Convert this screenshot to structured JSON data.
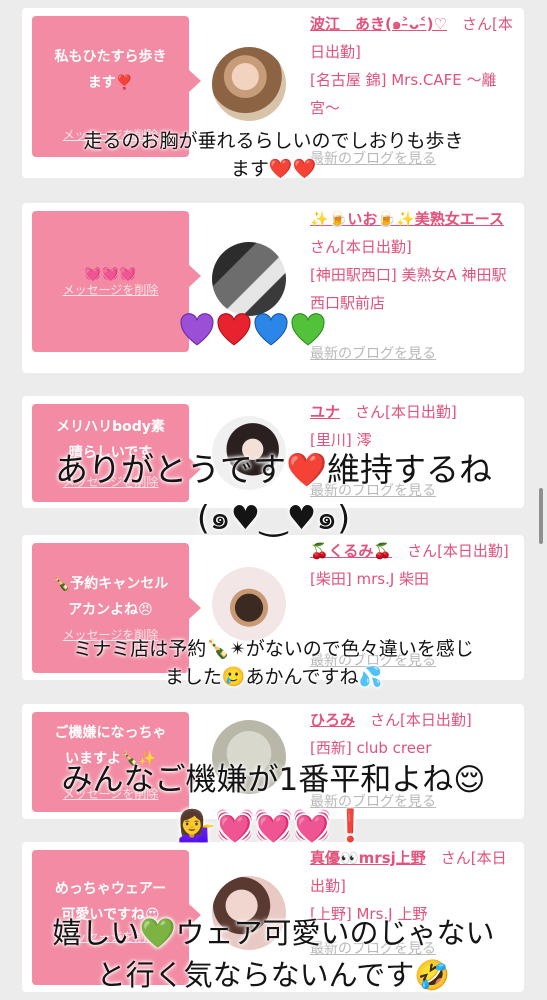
{
  "entries": [
    {
      "message": "私もひたすら歩き\nます❣️",
      "delete_label": "メッセージを削除",
      "name": "波江　あき(๑˃̵ᴗ˂̵)♡",
      "suffix": "さん[本日出勤]",
      "shop": "[名古屋 錦] Mrs.CAFE 〜離宮〜",
      "blog_link": "最新のブログを見る",
      "overlay": "走るのお胸が垂れるらしいのでしおりも歩き\nます❤️❤️"
    },
    {
      "message": "💓💓💓",
      "delete_label": "メッセージを削除",
      "name": "✨🍺いお🍺✨美熟女エース",
      "suffix": "さん[本日出勤]",
      "shop": "[神田駅西口] 美熟女A 神田駅西口駅前店",
      "blog_link": "最新のブログを見る",
      "overlay_hearts": [
        "purple-heart",
        "red-heart",
        "blue-heart",
        "green-heart"
      ]
    },
    {
      "message": "メリハリbody素\n晴らしいです",
      "delete_label": "メッセージを削除",
      "name": "ユナ",
      "suffix": "さん[本日出勤]",
      "shop": "[里川] 澪",
      "blog_link": "最新のブログを見る",
      "overlay": "ありがとうです❤️維持するね\n(๑♥‿♥๑)"
    },
    {
      "message": "🍾予約キャンセル\nアカンよね😠",
      "delete_label": "メッセージを削除",
      "name": "🍒くるみ🍒",
      "suffix": "さん[本日出勤]",
      "shop": "[柴田] mrs.J 柴田",
      "blog_link": "最新のブログを見る",
      "overlay": "ミナミ店は予約🍾✴︎がないので色々違いを感じ\nました🥲あかんですね💦"
    },
    {
      "message": "ご機嫌になっちゃ\nいますよ🍾✨",
      "delete_label": "メッセージを削除",
      "name": "ひろみ",
      "suffix": "さん[本日出勤]",
      "shop": "[西新] club creer",
      "blog_link": "最新のブログを見る",
      "overlay": "みんなご機嫌が1番平和よね😌\n💁‍♀️💓💓💓❗️"
    },
    {
      "message": "めっちゃウェアー\n可愛いですね😍",
      "delete_label": "メッセージを削除",
      "name": "真優👀mrsj上野",
      "suffix": "さん[本日出勤]",
      "shop": "[上野] Mrs.J 上野",
      "blog_link": "最新のブログを見る",
      "overlay": "嬉しい💚ウェア可愛いのじゃない\nと行く気ならないんです🤣"
    }
  ],
  "colors": {
    "accent": "#e2527b",
    "bubble": "#f28ba3"
  }
}
